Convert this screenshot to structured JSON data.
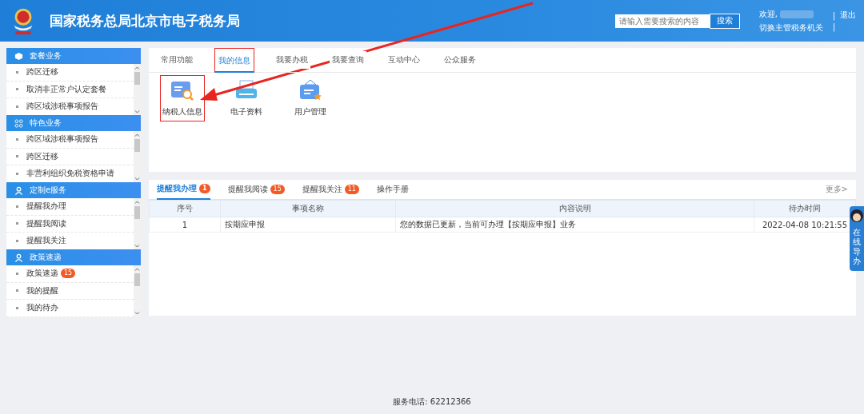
{
  "header": {
    "title": "国家税务总局北京市电子税务局",
    "search": {
      "placeholder": "请输入需要搜索的内容",
      "button": "搜索"
    },
    "welcome": "欢迎,",
    "switch": "切换主管税务机关",
    "divider_1": "|",
    "divider_2": "|",
    "logout": "退出"
  },
  "sidebar": [
    {
      "title": "套餐业务",
      "items": [
        "跨区迁移",
        "取消非正常户认定套餐",
        "跨区域涉税事项报告"
      ]
    },
    {
      "title": "特色业务",
      "items": [
        "跨区域涉税事项报告",
        "跨区迁移",
        "非营利组织免税资格申请"
      ]
    },
    {
      "title": "定制e服务",
      "items": [
        "提醒我办理",
        "提醒我阅读",
        "提醒我关注"
      ]
    },
    {
      "title": "政策速递",
      "items": [
        "政策速递",
        "我的提醒",
        "我的待办"
      ],
      "badge": "15"
    }
  ],
  "top_tabs": [
    {
      "label": "常用功能",
      "selected": false
    },
    {
      "label": "我的信息",
      "selected": true
    },
    {
      "label": "我要办税",
      "selected": false
    },
    {
      "label": "我要查询",
      "selected": false
    },
    {
      "label": "互动中心",
      "selected": false
    },
    {
      "label": "公众服务",
      "selected": false
    }
  ],
  "apps": [
    {
      "label": "纳税人信息",
      "kind": "taxpayer",
      "highlighted": true
    },
    {
      "label": "电子资料",
      "kind": "document",
      "highlighted": false
    },
    {
      "label": "用户管理",
      "kind": "user",
      "highlighted": false
    }
  ],
  "reminder_tabs": [
    {
      "label": "提醒我办理",
      "badge": "1",
      "selected": true
    },
    {
      "label": "提醒我阅读",
      "badge": "15",
      "selected": false
    },
    {
      "label": "提醒我关注",
      "badge": "11",
      "selected": false
    },
    {
      "label": "操作手册",
      "selected": false
    }
  ],
  "more": "更多>",
  "table": {
    "columns": [
      "序号",
      "事项名称",
      "内容说明",
      "待办时间"
    ],
    "rows": [
      [
        "1",
        "按期应申报",
        "您的数据已更新，当前可办理【按期应申报】业务",
        "2022-04-08 10:21:55"
      ]
    ]
  },
  "assistant": "在线导办",
  "footer": "服务电话: 62212366"
}
